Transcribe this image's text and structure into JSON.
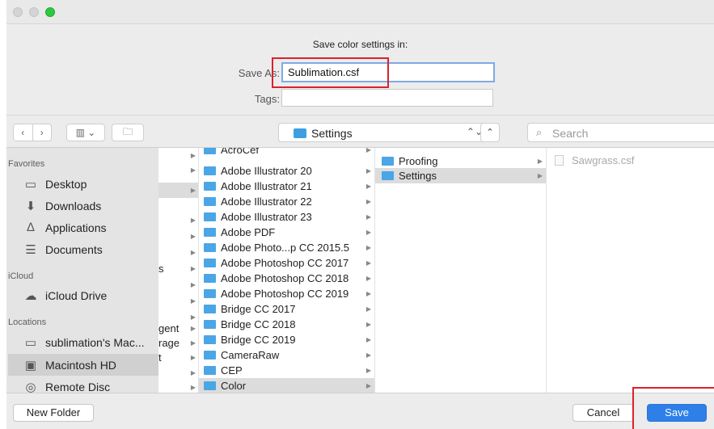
{
  "dialog": {
    "heading": "Save color settings in:",
    "save_as_label": "Save As:",
    "save_as_value": "Sublimation.csf",
    "tags_label": "Tags:",
    "tags_value": ""
  },
  "toolbar": {
    "back_icon": "chevron-left",
    "forward_icon": "chevron-right",
    "view_icon": "column-view",
    "new_folder_icon": "new-folder",
    "location": "Settings",
    "search_placeholder": "Search"
  },
  "sidebar": {
    "favorites_title": "Favorites",
    "favorites": [
      {
        "label": "Desktop",
        "icon": "desktop-icon"
      },
      {
        "label": "Downloads",
        "icon": "downloads-icon"
      },
      {
        "label": "Applications",
        "icon": "applications-icon"
      },
      {
        "label": "Documents",
        "icon": "documents-icon"
      }
    ],
    "icloud_title": "iCloud",
    "icloud": [
      {
        "label": "iCloud Drive",
        "icon": "cloud-icon"
      }
    ],
    "locations_title": "Locations",
    "locations": [
      {
        "label": "sublimation's Mac...",
        "icon": "computer-icon"
      },
      {
        "label": "Macintosh HD",
        "icon": "disk-icon",
        "selected": true
      },
      {
        "label": "Remote Disc",
        "icon": "disc-icon"
      }
    ]
  },
  "columns": {
    "col1_fragments": [
      "s",
      "gent",
      "rage",
      "t"
    ],
    "col2": [
      "AcroCef",
      "Adobe Illustrator 20",
      "Adobe Illustrator 21",
      "Adobe Illustrator 22",
      "Adobe Illustrator 23",
      "Adobe PDF",
      "Adobe Photo...p CC 2015.5",
      "Adobe Photoshop CC 2017",
      "Adobe Photoshop CC 2018",
      "Adobe Photoshop CC 2019",
      "Bridge CC 2017",
      "Bridge CC 2018",
      "Bridge CC 2019",
      "CameraRaw",
      "CEP",
      "Color"
    ],
    "col3": [
      "Proofing",
      "Settings"
    ],
    "col4": [
      "Sawgrass.csf"
    ]
  },
  "buttons": {
    "new_folder": "New Folder",
    "cancel": "Cancel",
    "save": "Save"
  },
  "colors": {
    "accent": "#2f7fe8",
    "folder": "#4aa6e6",
    "highlight_box": "#d9232e"
  }
}
